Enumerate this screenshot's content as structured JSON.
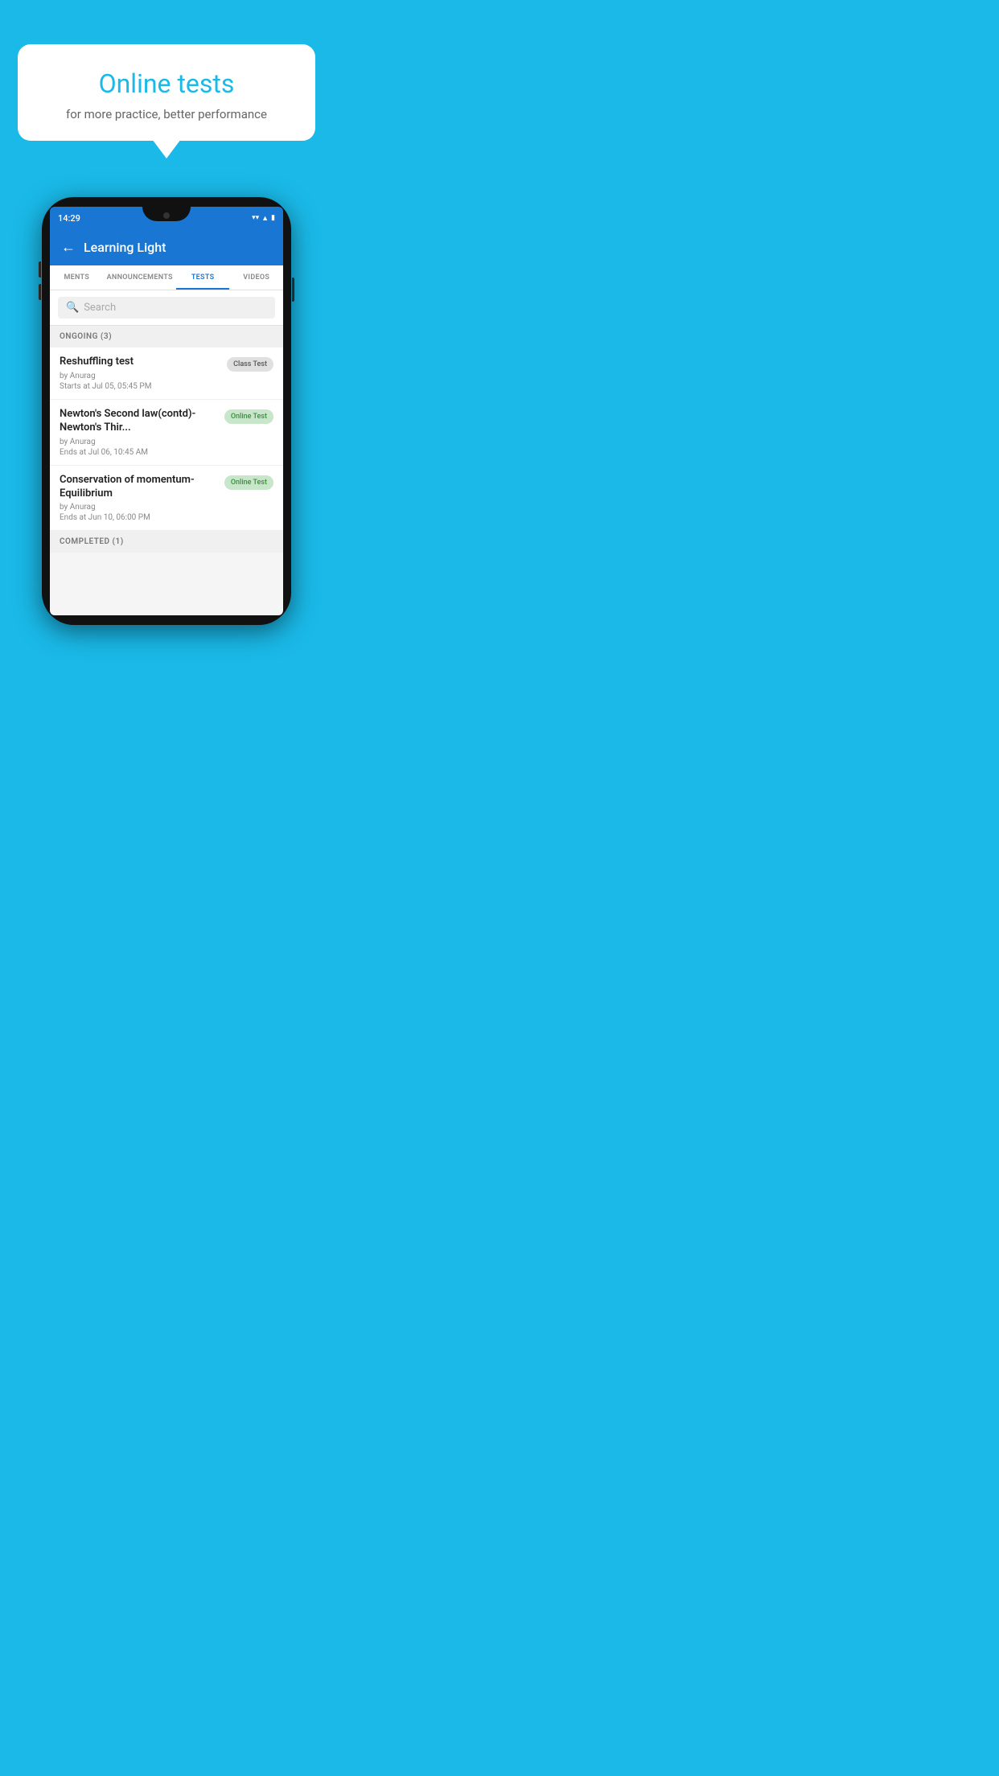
{
  "background": {
    "color": "#1ab9e8"
  },
  "speech_bubble": {
    "title": "Online tests",
    "subtitle": "for more practice, better performance"
  },
  "phone": {
    "time": "14:29",
    "status_icons": [
      "wifi",
      "signal",
      "battery"
    ],
    "app": {
      "title": "Learning Light",
      "tabs": [
        {
          "label": "MENTS",
          "active": false
        },
        {
          "label": "ANNOUNCEMENTS",
          "active": false
        },
        {
          "label": "TESTS",
          "active": true
        },
        {
          "label": "VIDEOS",
          "active": false
        }
      ],
      "search": {
        "placeholder": "Search"
      },
      "ongoing_section": {
        "label": "ONGOING (3)"
      },
      "tests": [
        {
          "title": "Reshuffling test",
          "author": "by Anurag",
          "date": "Starts at  Jul 05, 05:45 PM",
          "badge": "Class Test",
          "badge_type": "class"
        },
        {
          "title": "Newton's Second law(contd)-Newton's Thir...",
          "author": "by Anurag",
          "date": "Ends at  Jul 06, 10:45 AM",
          "badge": "Online Test",
          "badge_type": "online"
        },
        {
          "title": "Conservation of momentum-Equilibrium",
          "author": "by Anurag",
          "date": "Ends at  Jun 10, 06:00 PM",
          "badge": "Online Test",
          "badge_type": "online"
        }
      ],
      "completed_section": {
        "label": "COMPLETED (1)"
      }
    }
  }
}
